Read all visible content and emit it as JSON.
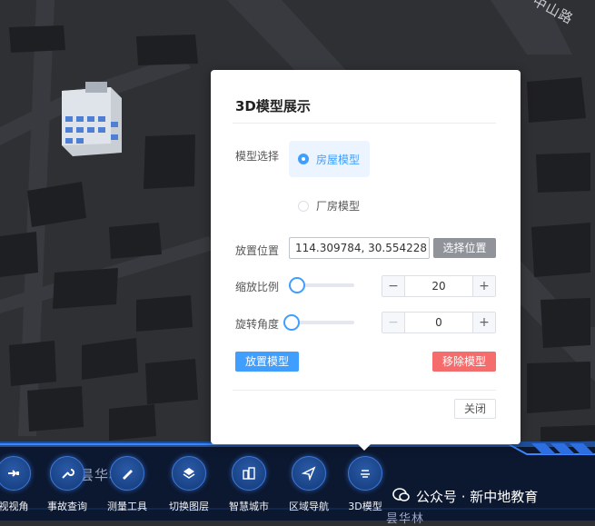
{
  "map": {
    "street_label_top": "中山路",
    "area_label": "昙华林",
    "area_label_bottom": "昙华林"
  },
  "dialog": {
    "title": "3D模型展示",
    "model_select_label": "模型选择",
    "options": [
      "房屋模型",
      "厂房模型"
    ],
    "selected_option": "房屋模型",
    "position_label": "放置位置",
    "position_value": "114.309784, 30.554228",
    "select_position_button": "选择位置",
    "scale_label": "缩放比例",
    "scale_value": "20",
    "scale_slider_fraction": 0.08,
    "rotate_label": "旋转角度",
    "rotate_value": "0",
    "rotate_slider_fraction": 0,
    "place_button": "放置模型",
    "remove_button": "移除模型",
    "close_button": "关闭"
  },
  "toolbar": {
    "items": [
      {
        "label": "视视角",
        "icon": "view-angle-icon"
      },
      {
        "label": "事故查询",
        "icon": "wrench-icon"
      },
      {
        "label": "测量工具",
        "icon": "ruler-pen-icon"
      },
      {
        "label": "切换图层",
        "icon": "layers-icon"
      },
      {
        "label": "智慧城市",
        "icon": "city-buildings-icon"
      },
      {
        "label": "区域导航",
        "icon": "navigation-arrow-icon"
      },
      {
        "label": "3D模型",
        "icon": "3d-model-icon"
      }
    ]
  },
  "watermark": {
    "text": "公众号 · 新中地教育"
  },
  "colors": {
    "primary": "#409eff",
    "secondary_button": "#909399",
    "danger_button": "#f56c6c",
    "map_background": "#2e2f33",
    "toolbar_accent": "#3d78d8"
  }
}
